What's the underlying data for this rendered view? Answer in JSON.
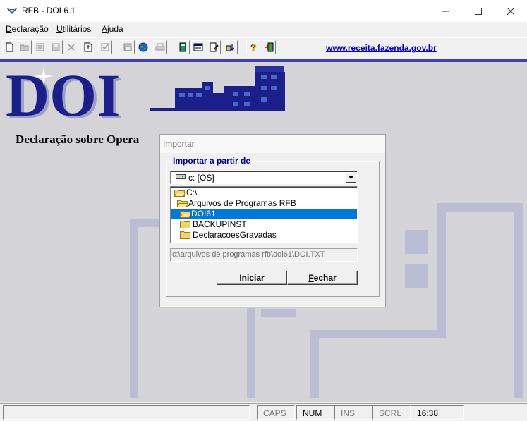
{
  "window": {
    "title": "RFB - DOI 6.1",
    "controls": {
      "minimize": "minimize-icon",
      "maximize": "maximize-icon",
      "close": "close-icon"
    }
  },
  "menu": [
    {
      "label": "Declaração",
      "hotkey": "D"
    },
    {
      "label": "Utilitários",
      "hotkey": "U"
    },
    {
      "label": "Ajuda",
      "hotkey": "A"
    }
  ],
  "toolbar": {
    "buttons": [
      {
        "icon": "new-document-icon",
        "enabled": true
      },
      {
        "icon": "open-folder-icon",
        "enabled": false
      },
      {
        "icon": "list-icon",
        "enabled": false
      },
      {
        "icon": "save-icon",
        "enabled": false
      },
      {
        "icon": "delete-icon",
        "enabled": false
      },
      {
        "icon": "import-icon",
        "enabled": true
      },
      {
        "icon": "check-icon",
        "enabled": false
      },
      {
        "icon": "disk-icon",
        "enabled": false
      },
      {
        "icon": "globe-icon",
        "enabled": true
      },
      {
        "icon": "print-icon",
        "enabled": false
      },
      {
        "icon": "calculator-icon",
        "enabled": true
      },
      {
        "icon": "form-icon",
        "enabled": true
      },
      {
        "icon": "edit-document-icon",
        "enabled": true
      },
      {
        "icon": "transfer-icon",
        "enabled": true
      },
      {
        "icon": "help-icon",
        "enabled": true
      },
      {
        "icon": "exit-icon",
        "enabled": true
      }
    ],
    "site_link": "www.receita.fazenda.gov.br"
  },
  "main": {
    "logo_text": "DOI",
    "declaration_title": "Declaração sobre Opera"
  },
  "dialog": {
    "title": "Importar",
    "group_label": "Importar a partir de",
    "drive": "c: [OS]",
    "directories": [
      {
        "name": "C:\\",
        "level": 0,
        "state": "open",
        "selected": false
      },
      {
        "name": "Arquivos de Programas RFB",
        "level": 1,
        "state": "open",
        "selected": false
      },
      {
        "name": "DOI61",
        "level": 2,
        "state": "open",
        "selected": true
      },
      {
        "name": "BACKUPINST",
        "level": 2,
        "state": "closed",
        "selected": false
      },
      {
        "name": "DeclaracoesGravadas",
        "level": 2,
        "state": "closed",
        "selected": false
      }
    ],
    "file_path": "c:\\arquivos de programas rfb\\doi61\\DOI.TXT",
    "buttons": {
      "start": "Iniciar",
      "close": "Fechar"
    }
  },
  "statusbar": {
    "message": "",
    "caps": "CAPS",
    "num": "NUM",
    "ins": "INS",
    "scrl": "SCRL",
    "time": "16:38"
  },
  "colors": {
    "accent_blue": "#0000cc",
    "logo_blue": "#1b1f8a",
    "selection": "#0078d7"
  }
}
